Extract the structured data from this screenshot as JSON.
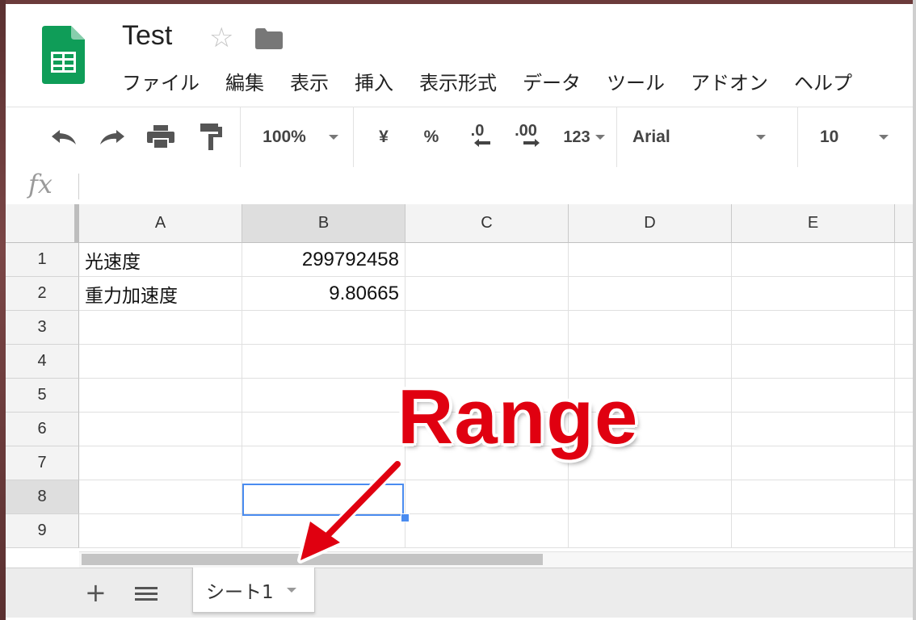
{
  "document": {
    "title": "Test",
    "star_icon": "star-outline-icon",
    "folder_icon": "folder-icon"
  },
  "menu": [
    "ファイル",
    "編集",
    "表示",
    "挿入",
    "表示形式",
    "データ",
    "ツール",
    "アドオン",
    "ヘルプ"
  ],
  "toolbar": {
    "undo_icon": "undo-icon",
    "redo_icon": "redo-icon",
    "print_icon": "print-icon",
    "paint_format_icon": "paint-format-icon",
    "zoom": "100%",
    "currency": "¥",
    "percent": "%",
    "decrease_decimal": ".0",
    "increase_decimal": ".00",
    "more_formats": "123",
    "font": "Arial",
    "font_size": "10"
  },
  "formula_bar": {
    "label": "fx",
    "value": ""
  },
  "columns": [
    "A",
    "B",
    "C",
    "D",
    "E"
  ],
  "rows": [
    "1",
    "2",
    "3",
    "4",
    "5",
    "6",
    "7",
    "8",
    "9"
  ],
  "cells": {
    "A1": "光速度",
    "B1": "299792458",
    "A2": "重力加速度",
    "B2": "9.80665"
  },
  "selected_cell": "B8",
  "sheets": {
    "add_icon": "plus-icon",
    "list_icon": "menu-list-icon",
    "active_tab": "シート1"
  },
  "annotation": {
    "text": "Range",
    "color": "#e00010"
  },
  "colors": {
    "sheets_green": "#0f9d58",
    "selection_blue": "#4a8cf0"
  }
}
